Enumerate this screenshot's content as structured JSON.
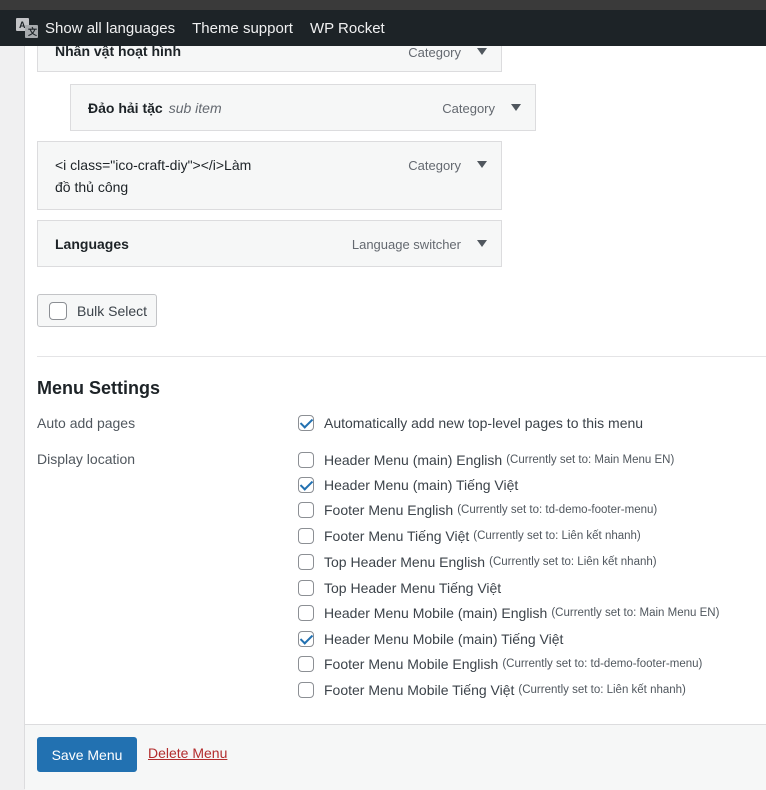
{
  "admin_bar": {
    "show_all_languages": "Show all languages",
    "theme_support": "Theme support",
    "wp_rocket": "WP Rocket"
  },
  "menu_items": [
    {
      "title": "Nhân vật hoạt hình",
      "type": "Category"
    },
    {
      "title": "Đảo hải tặc",
      "sub_label": "sub item",
      "type": "Category"
    },
    {
      "title_line1": "<i class=\"ico-craft-diy\"></i>Làm",
      "title_line2": "đồ thủ công",
      "type": "Category"
    },
    {
      "title": "Languages",
      "type": "Language switcher"
    }
  ],
  "bulk_select": {
    "label": "Bulk Select",
    "checked": false
  },
  "menu_settings": {
    "title": "Menu Settings",
    "auto_add": {
      "label": "Auto add pages",
      "option": {
        "label": "Automatically add new top-level pages to this menu",
        "checked": true
      }
    },
    "display_location": {
      "label": "Display location",
      "options": [
        {
          "label": "Header Menu (main) English",
          "note": "(Currently set to: Main Menu EN)",
          "checked": false
        },
        {
          "label": "Header Menu (main) Tiếng Việt",
          "note": "",
          "checked": true
        },
        {
          "label": "Footer Menu English",
          "note": "(Currently set to: td-demo-footer-menu)",
          "checked": false
        },
        {
          "label": "Footer Menu Tiếng Việt",
          "note": "(Currently set to: Liên kết nhanh)",
          "checked": false
        },
        {
          "label": "Top Header Menu English",
          "note": "(Currently set to: Liên kết nhanh)",
          "checked": false
        },
        {
          "label": "Top Header Menu Tiếng Việt",
          "note": "",
          "checked": false
        },
        {
          "label": "Header Menu Mobile (main) English",
          "note": "(Currently set to: Main Menu EN)",
          "checked": false
        },
        {
          "label": "Header Menu Mobile (main) Tiếng Việt",
          "note": "",
          "checked": true
        },
        {
          "label": "Footer Menu Mobile English",
          "note": "(Currently set to: td-demo-footer-menu)",
          "checked": false
        },
        {
          "label": "Footer Menu Mobile Tiếng Việt",
          "note": "(Currently set to: Liên kết nhanh)",
          "checked": false
        }
      ]
    }
  },
  "footer": {
    "save_label": "Save Menu",
    "delete_label": "Delete Menu"
  },
  "colors": {
    "primary": "#2271b1",
    "danger": "#b32d2e",
    "admin_bar": "#1d2327"
  }
}
